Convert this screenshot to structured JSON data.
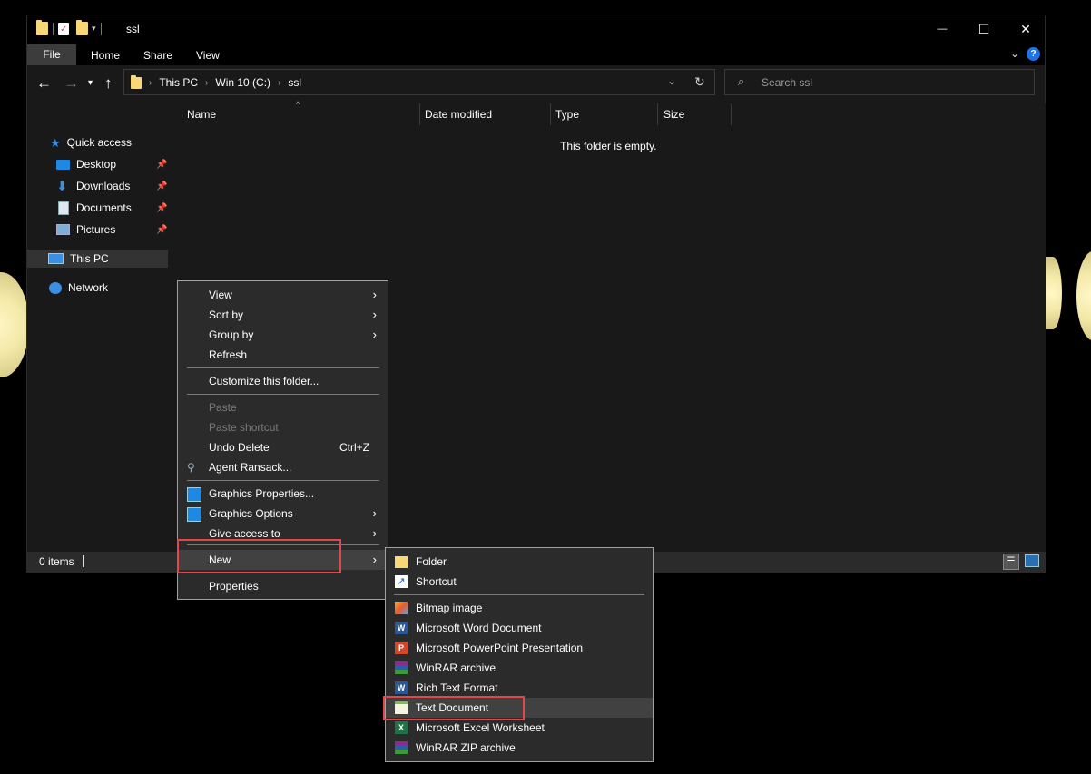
{
  "window": {
    "title": "ssl",
    "controls": {
      "minimize": "—",
      "maximize": "☐",
      "close": "✕"
    }
  },
  "ribbon": {
    "tabs": [
      "File",
      "Home",
      "Share",
      "View"
    ]
  },
  "address": {
    "crumbs": [
      "This PC",
      "Win 10 (C:)",
      "ssl"
    ],
    "search_placeholder": "Search ssl"
  },
  "nav_pane": {
    "quick_access": "Quick access",
    "pinned": [
      "Desktop",
      "Downloads",
      "Documents",
      "Pictures"
    ],
    "this_pc": "This PC",
    "network": "Network"
  },
  "columns": [
    "Name",
    "Date modified",
    "Type",
    "Size"
  ],
  "empty_message": "This folder is empty.",
  "status": {
    "items": "0 items"
  },
  "context_menu": {
    "view": "View",
    "sort_by": "Sort by",
    "group_by": "Group by",
    "refresh": "Refresh",
    "customize": "Customize this folder...",
    "paste": "Paste",
    "paste_shortcut": "Paste shortcut",
    "undo_delete": "Undo Delete",
    "undo_shortcut": "Ctrl+Z",
    "agent_ransack": "Agent Ransack...",
    "graphics_properties": "Graphics Properties...",
    "graphics_options": "Graphics Options",
    "give_access": "Give access to",
    "new": "New",
    "properties": "Properties"
  },
  "new_submenu": {
    "folder": "Folder",
    "shortcut": "Shortcut",
    "bitmap": "Bitmap image",
    "word": "Microsoft Word Document",
    "powerpoint": "Microsoft PowerPoint Presentation",
    "winrar": "WinRAR archive",
    "rtf": "Rich Text Format",
    "text": "Text Document",
    "excel": "Microsoft Excel Worksheet",
    "winrar_zip": "WinRAR ZIP archive"
  },
  "highlight_color": "#e2474a"
}
